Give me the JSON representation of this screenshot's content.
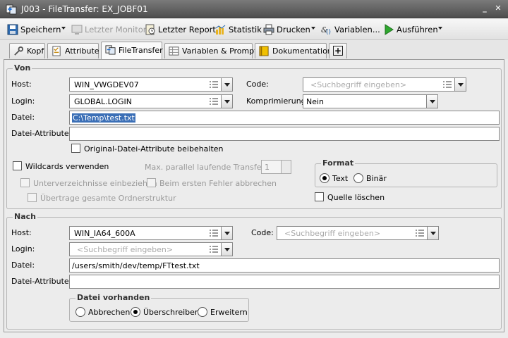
{
  "window": {
    "title": "J003 - FileTransfer: EX_JOBF01",
    "min_glyph": "_",
    "close_glyph": "✕"
  },
  "toolbar": {
    "save": "Speichern",
    "last_monitor": "Letzter Monitor",
    "last_report": "Letzter Report",
    "statistics": "Statistik",
    "print": "Drucken",
    "variables": "Variablen...",
    "execute": "Ausführen"
  },
  "tabs": [
    "Kopf",
    "Attribute",
    "FileTransfer",
    "Variablen & Prompts",
    "Dokumentation"
  ],
  "tab_add_label": "+",
  "active_tab": "FileTransfer",
  "von": {
    "title": "Von",
    "host_label": "Host:",
    "host_value": "WIN_VWGDEV07",
    "code_label": "Code:",
    "code_placeholder": "<Suchbegriff eingeben>",
    "login_label": "Login:",
    "login_value": "GLOBAL.LOGIN",
    "compression_label": "Komprimierung:",
    "compression_value": "Nein",
    "file_label": "Datei:",
    "file_value": "C:\\Temp\\test.txt",
    "file_attr_label": "Datei-Attribute:",
    "file_attr_value": "",
    "keep_attr_label": "Original-Datei-Attribute beibehalten",
    "wildcards_label": "Wildcards verwenden",
    "max_parallel_label": "Max. parallel laufende Transfers:",
    "max_parallel_value": "1",
    "subdirs_label": "Unterverzeichnisse einbeziehen",
    "abort_first_error_label": "Beim ersten Fehler abbrechen",
    "transfer_structure_label": "Übertrage gesamte Ordnerstruktur",
    "format_title": "Format",
    "format_options": [
      "Text",
      "Binär"
    ],
    "format_selected": "Text",
    "delete_source_label": "Quelle löschen"
  },
  "nach": {
    "title": "Nach",
    "host_label": "Host:",
    "host_value": "WIN_IA64_600A",
    "code_label": "Code:",
    "code_placeholder": "<Suchbegriff eingeben>",
    "login_label": "Login:",
    "login_placeholder": "<Suchbegriff eingeben>",
    "file_label": "Datei:",
    "file_value": "/users/smith/dev/temp/FTtest.txt",
    "file_attr_label": "Datei-Attribute:",
    "file_attr_value": "",
    "exists_title": "Datei vorhanden",
    "exists_options": [
      "Abbrechen",
      "Überschreiben",
      "Erweitern"
    ],
    "exists_selected": "Überschreiben"
  },
  "colors": {
    "title_bar": "#5a5a5a",
    "selection": "#3b6fb6",
    "panel": "#ececec"
  }
}
